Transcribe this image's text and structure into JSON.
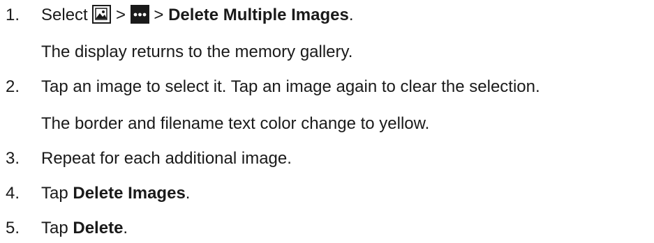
{
  "steps": [
    {
      "number": "1.",
      "parts": {
        "select": "Select",
        "sep1": ">",
        "sep2": ">",
        "command": "Delete Multiple Images",
        "end": "."
      },
      "icons": [
        "gallery-icon",
        "more-options-icon"
      ],
      "note": "The display returns to the memory gallery."
    },
    {
      "number": "2.",
      "text": "Tap an image to select it. Tap an image again to clear the selection.",
      "note": "The border and filename text color change to yellow."
    },
    {
      "number": "3.",
      "text": "Repeat for each additional image."
    },
    {
      "number": "4.",
      "prefix": "Tap",
      "bold": "Delete Images",
      "end": "."
    },
    {
      "number": "5.",
      "prefix": "Tap",
      "bold": "Delete",
      "end": "."
    }
  ]
}
